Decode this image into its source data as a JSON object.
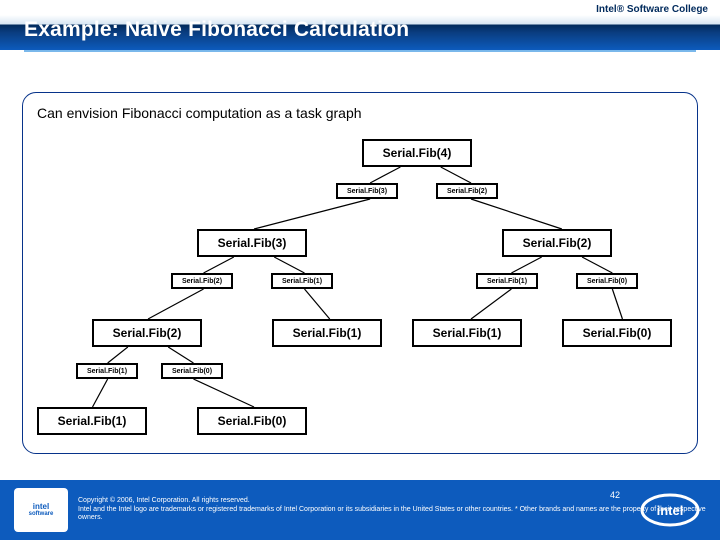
{
  "header": {
    "tag": "Intel® Software College",
    "title": "Example: Naive Fibonacci Calculation"
  },
  "lead": "Can envision Fibonacci computation as a task graph",
  "nodes": {
    "root": "Serial.Fib(4)",
    "root_l": "Serial.Fib(3)",
    "root_r": "Serial.Fib(2)",
    "l3": "Serial.Fib(3)",
    "r2": "Serial.Fib(2)",
    "l3_l": "Serial.Fib(2)",
    "l3_r": "Serial.Fib(1)",
    "r2_l": "Serial.Fib(1)",
    "r2_r": "Serial.Fib(0)",
    "l2": "Serial.Fib(2)",
    "m1a": "Serial.Fib(1)",
    "m1b": "Serial.Fib(1)",
    "r0": "Serial.Fib(0)",
    "l2_l": "Serial.Fib(1)",
    "l2_r": "Serial.Fib(0)",
    "b1": "Serial.Fib(1)",
    "b0": "Serial.Fib(0)"
  },
  "footer": {
    "logotop": "intel",
    "logosub": "software",
    "line1": "Copyright © 2006, Intel Corporation. All rights reserved.",
    "line2": "Intel and the Intel logo are trademarks or registered trademarks of Intel Corporation or its subsidiaries in the United States or other countries. * Other brands and names are the property of their respective owners.",
    "page": "42"
  }
}
